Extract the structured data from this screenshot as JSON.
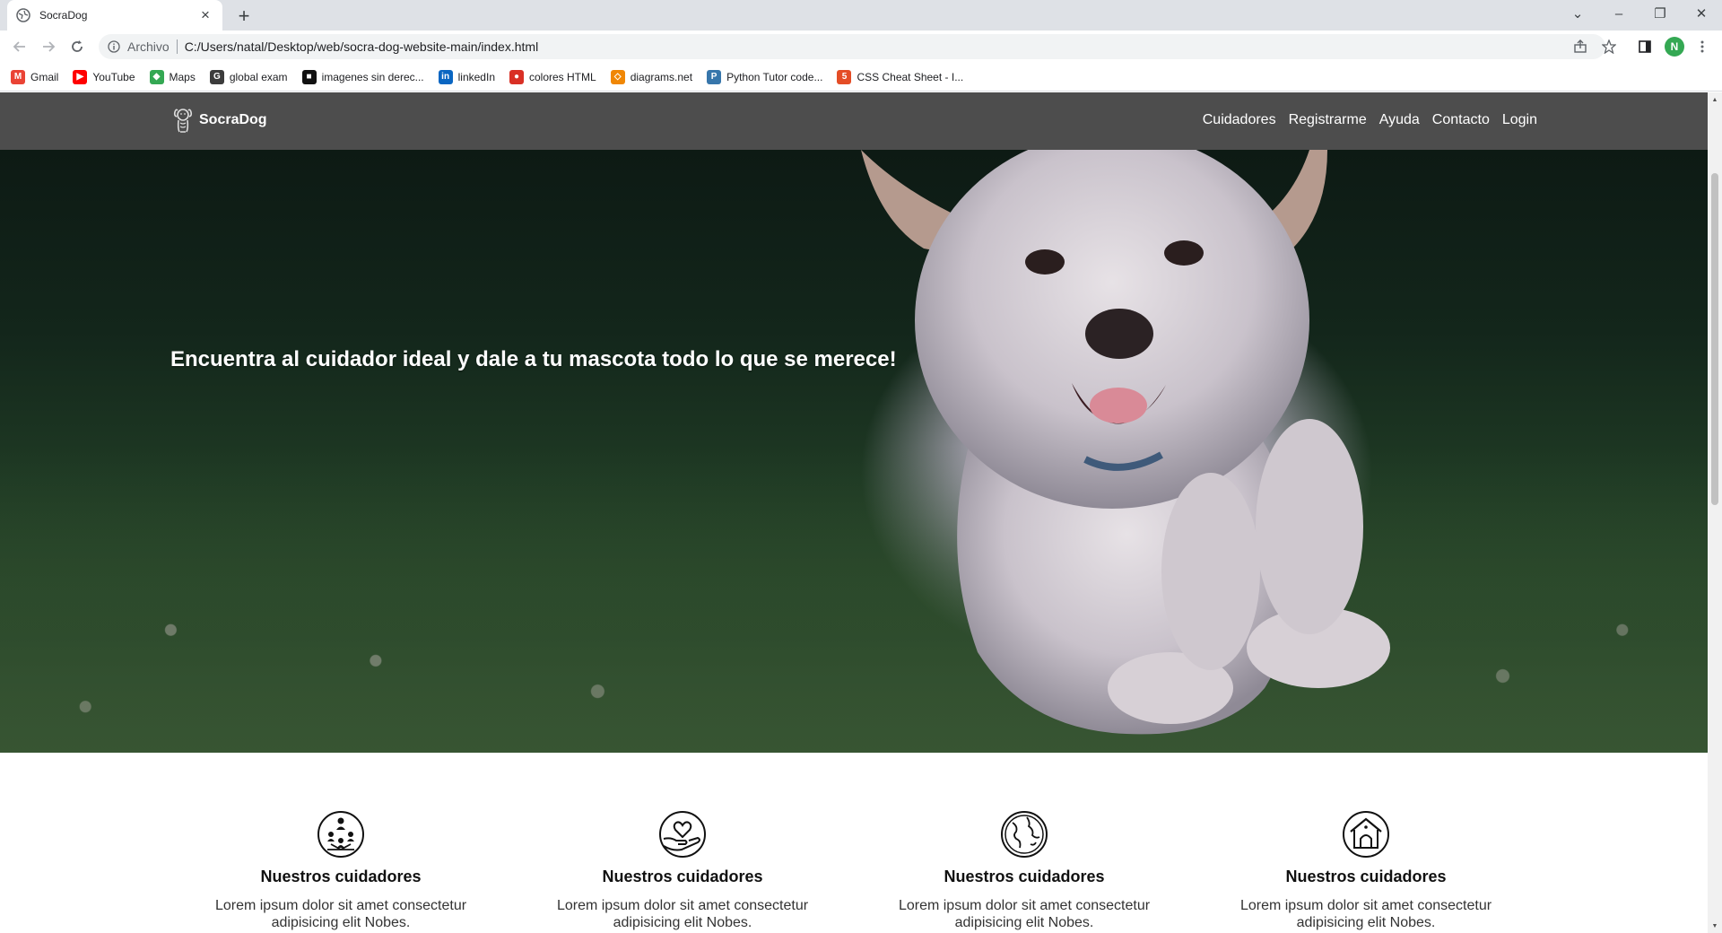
{
  "browser": {
    "tab_title": "SocraDog",
    "new_tab_symbol": "+",
    "url_chip": "Archivo",
    "url": "C:/Users/natal/Desktop/web/socra-dog-website-main/index.html",
    "profile_initial": "N",
    "bookmarks": [
      {
        "label": "Gmail",
        "icon": "gmail-icon",
        "color": "#ea4335",
        "glyph": "M"
      },
      {
        "label": "YouTube",
        "icon": "youtube-icon",
        "color": "#ff0000",
        "glyph": "▶"
      },
      {
        "label": "Maps",
        "icon": "maps-icon",
        "color": "#34a853",
        "glyph": "◆"
      },
      {
        "label": "global exam",
        "icon": "global-exam-icon",
        "color": "#3c3c3c",
        "glyph": "G"
      },
      {
        "label": "imagenes sin derec...",
        "icon": "unsplash-icon",
        "color": "#111111",
        "glyph": "■"
      },
      {
        "label": "linkedIn",
        "icon": "linkedin-icon",
        "color": "#0a66c2",
        "glyph": "in"
      },
      {
        "label": "colores HTML",
        "icon": "colores-html-icon",
        "color": "#d93025",
        "glyph": "●"
      },
      {
        "label": "diagrams.net",
        "icon": "diagrams-icon",
        "color": "#f08705",
        "glyph": "◇"
      },
      {
        "label": "Python Tutor code...",
        "icon": "python-icon",
        "color": "#3776ab",
        "glyph": "P"
      },
      {
        "label": "CSS Cheat Sheet - I...",
        "icon": "css-cheatsheet-icon",
        "color": "#e44d26",
        "glyph": "5"
      }
    ]
  },
  "site": {
    "brand": "SocraDog",
    "nav": [
      "Cuidadores",
      "Registrarme",
      "Ayuda",
      "Contacto",
      "Login"
    ],
    "hero_title": "Encuentra al cuidador ideal y dale a tu mascota todo lo que se merece!",
    "features": [
      {
        "icon": "people-network-icon",
        "title": "Nuestros cuidadores",
        "text_line1": "Lorem ipsum dolor sit amet consectetur",
        "text_line2": "adipisicing elit Nobes."
      },
      {
        "icon": "heart-hand-icon",
        "title": "Nuestros cuidadores",
        "text_line1": "Lorem ipsum dolor sit amet consectetur",
        "text_line2": "adipisicing elit Nobes."
      },
      {
        "icon": "globe-icon",
        "title": "Nuestros cuidadores",
        "text_line1": "Lorem ipsum dolor sit amet consectetur",
        "text_line2": "adipisicing elit Nobes."
      },
      {
        "icon": "dog-house-icon",
        "title": "Nuestros cuidadores",
        "text_line1": "Lorem ipsum dolor sit amet consectetur",
        "text_line2": "adipisicing elit Nobes."
      }
    ]
  }
}
